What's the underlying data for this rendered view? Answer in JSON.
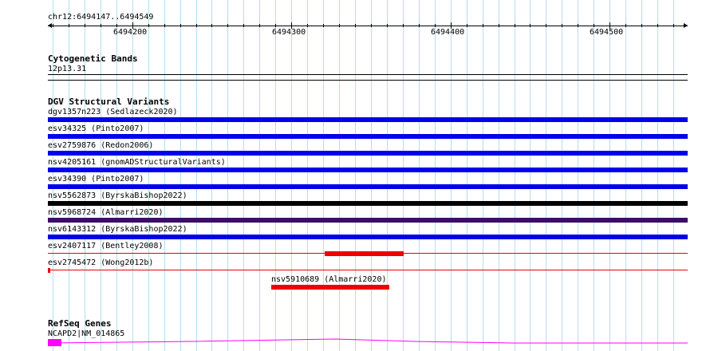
{
  "position": "chr12:6494147..6494549",
  "ruler": {
    "start": 6494147,
    "end": 6494549,
    "tick_labels": [
      "6494200",
      "6494300",
      "6494400",
      "6494500"
    ]
  },
  "tracks": {
    "cytoband": {
      "title": "Cytogenetic Bands",
      "band": "12p13.31"
    },
    "dgv": {
      "title": "DGV Structural Variants",
      "features": [
        {
          "label": "dgv1357n223 (Sedlazeck2020)",
          "color": "#0000ee",
          "style": "bar"
        },
        {
          "label": "esv34325 (Pinto2007)",
          "color": "#0000ee",
          "style": "bar"
        },
        {
          "label": "esv2759876 (Redon2006)",
          "color": "#0000ee",
          "style": "bar"
        },
        {
          "label": "nsv4205161 (gnomADStructuralVariants)",
          "color": "#0000ee",
          "style": "bar"
        },
        {
          "label": "esv34390 (Pinto2007)",
          "color": "#0000ee",
          "style": "bar"
        },
        {
          "label": "nsv5562873 (ByrskaBishop2022)",
          "color": "#000000",
          "style": "bar"
        },
        {
          "label": "nsv5968724 (Almarri2020)",
          "color": "#3b0d6b",
          "style": "bar"
        },
        {
          "label": "nsv6143312 (ByrskaBishop2022)",
          "color": "#0000ee",
          "style": "bar"
        },
        {
          "label": "esv2407117 (Bentley2008)",
          "color": "#ee0000",
          "style": "line"
        },
        {
          "label": "esv2745472 (Wong2012b)",
          "color": "#ee0000",
          "style": "line"
        }
      ],
      "extra_feature": {
        "label": "nsv5910689 (Almarri2020)",
        "color": "#ee0000",
        "style": "bar"
      }
    },
    "refseq": {
      "title": "RefSeq Genes",
      "gene": "NCAPD2|NM_014865",
      "color": "#ff00ff"
    }
  }
}
